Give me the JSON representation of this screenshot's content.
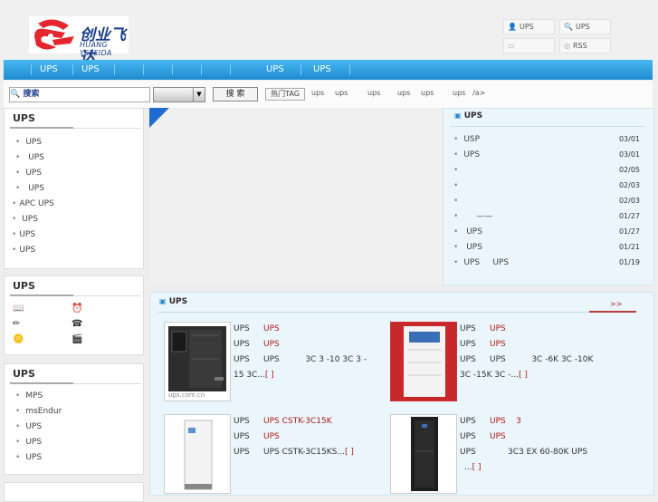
{
  "logo": {
    "text": "创业飞达",
    "sub": "HUANG YEFEIDA"
  },
  "top_links": [
    {
      "icon": "user-icon",
      "glyph": "👤",
      "label": "UPS"
    },
    {
      "icon": "search-icon",
      "glyph": "🔍",
      "label": "UPS"
    },
    {
      "icon": "folder-icon",
      "glyph": "▭",
      "label": ""
    },
    {
      "icon": "rss-icon",
      "glyph": "◎",
      "label": "RSS"
    }
  ],
  "nav": [
    "UPS",
    "UPS",
    "",
    "",
    "",
    "",
    "UPS",
    "UPS"
  ],
  "search": {
    "placeholder": "🔍 搜索",
    "button": "搜 索",
    "hot_tag": "热门TAG",
    "hot_items": [
      "ups",
      "ups",
      "ups",
      "ups",
      "ups",
      "ups",
      "/a>"
    ]
  },
  "categories": {
    "title": "UPS",
    "items": [
      "UPS",
      "UPS",
      "UPS",
      "UPS",
      "APC UPS",
      "UPS",
      "UPS",
      "UPS"
    ]
  },
  "services": {
    "title": "UPS",
    "icons": [
      "book-icon",
      "clock-icon",
      "pencil-icon",
      "telephone-icon",
      "coin-icon",
      "film-icon"
    ]
  },
  "brands": {
    "title": "UPS",
    "items": [
      "MPS",
      "msEndur",
      "UPS",
      "UPS",
      "UPS"
    ]
  },
  "news": {
    "title": "UPS",
    "items": [
      {
        "text": "USP",
        "date": "03/01"
      },
      {
        "text": "UPS",
        "date": "03/01"
      },
      {
        "text": "",
        "date": "02/05"
      },
      {
        "text": "",
        "date": "02/03"
      },
      {
        "text": "",
        "date": "02/03"
      },
      {
        "text": "——",
        "date": "01/27"
      },
      {
        "text": "UPS",
        "date": "01/27"
      },
      {
        "text": "UPS",
        "date": "01/21"
      },
      {
        "text": "UPS     UPS",
        "date": "01/19"
      }
    ]
  },
  "products": {
    "title": "UPS",
    "more": ">>",
    "items": [
      {
        "rows": [
          {
            "k": "UPS",
            "v": "UPS",
            "red": true
          },
          {
            "k": "UPS",
            "v": "UPS",
            "red": true
          },
          {
            "k": "UPS",
            "v": "UPS          3C 3 -10 3C 3 -",
            "red": false
          }
        ],
        "extra": "15 3C...",
        "link": "[ ]",
        "caption": "ups.com.cn"
      },
      {
        "rows": [
          {
            "k": "UPS",
            "v": "UPS",
            "red": true
          },
          {
            "k": "UPS",
            "v": "UPS",
            "red": true
          },
          {
            "k": "UPS",
            "v": "UPS          3C -6K 3C -10K",
            "red": false
          }
        ],
        "extra": "3C -15K 3C -...",
        "link": "[ ]"
      },
      {
        "rows": [
          {
            "k": "UPS",
            "v": "UPS CSTK-3C15K",
            "red": true
          },
          {
            "k": "UPS",
            "v": "UPS",
            "red": true
          },
          {
            "k": "UPS",
            "v": "UPS CSTK-3C15KS...",
            "red": false
          }
        ],
        "extra": "",
        "link": "[ ]"
      },
      {
        "rows": [
          {
            "k": "UPS",
            "v": "UPS    3",
            "red": true
          },
          {
            "k": "UPS",
            "v": "UPS",
            "red": true
          },
          {
            "k": "UPS",
            "v": "       3C3 EX 60-80K UPS",
            "red": false
          }
        ],
        "extra": "...",
        "link": "[ ]"
      }
    ]
  },
  "colors": {
    "nav": "#2a9fe0",
    "accent_red": "#b01818",
    "news_bg": "#eaf6fb"
  }
}
